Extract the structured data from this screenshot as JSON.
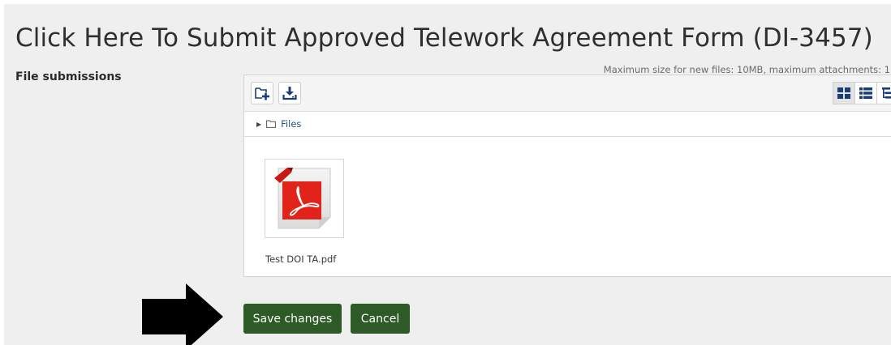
{
  "page": {
    "title": "Click Here To Submit Approved Telework Agreement Form (DI-3457)"
  },
  "file_submissions": {
    "label": "File submissions",
    "max_info": "Maximum size for new files: 10MB, maximum attachments: 1",
    "path": {
      "root_label": "Files"
    },
    "view_modes": [
      "grid",
      "list",
      "tree"
    ],
    "active_view": "grid",
    "files": [
      {
        "name": "Test DOI TA.pdf",
        "icon": "pdf-icon"
      }
    ]
  },
  "actions": {
    "save_label": "Save changes",
    "cancel_label": "Cancel"
  },
  "colors": {
    "primary_button": "#2d5a27",
    "link": "#1f4e8c",
    "toolbar_icon": "#1a3d7a",
    "pdf_red": "#e2231a"
  }
}
